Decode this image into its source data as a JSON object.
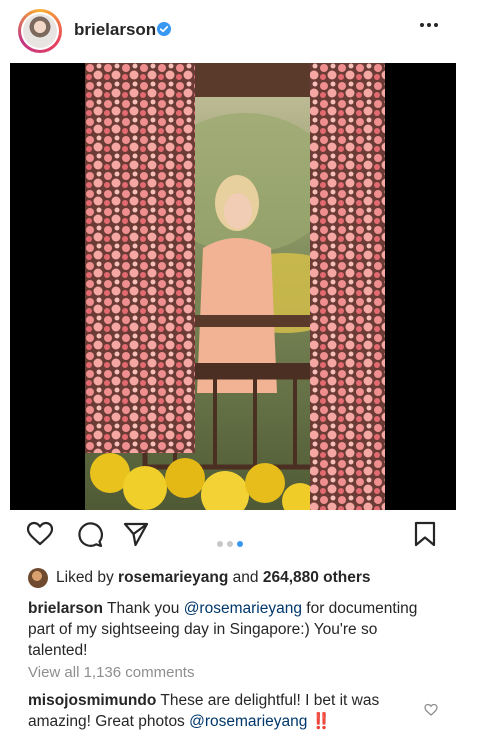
{
  "post": {
    "username": "brielarson",
    "verified": true,
    "carousel": {
      "total": 3,
      "active_index": 2
    },
    "likes": {
      "prefix": "Liked by",
      "liker": "rosemarieyang",
      "joiner": "and",
      "count": "264,880 others"
    },
    "caption": {
      "username": "brielarson",
      "text_before": "Thank you",
      "mention": "@rosemarieyang",
      "text_after": "for documenting part of my sightseeing day in Singapore:) You're so talented!"
    },
    "view_all_comments": "View all 1,136 comments",
    "comment": {
      "username": "misojosmimundo",
      "text": "These are delightful! I bet it was amazing! Great photos",
      "mention": "@rosemarieyang",
      "emoji": "‼️"
    },
    "icons": {
      "more": "more-options-icon",
      "like": "heart-icon",
      "comment": "comment-icon",
      "share": "send-icon",
      "save": "bookmark-icon",
      "verified": "verified-badge-icon"
    },
    "colors": {
      "accent": "#3897f0",
      "link": "#00376b",
      "muted": "#8e8e8e",
      "emoji_red": "#e0311d"
    }
  }
}
